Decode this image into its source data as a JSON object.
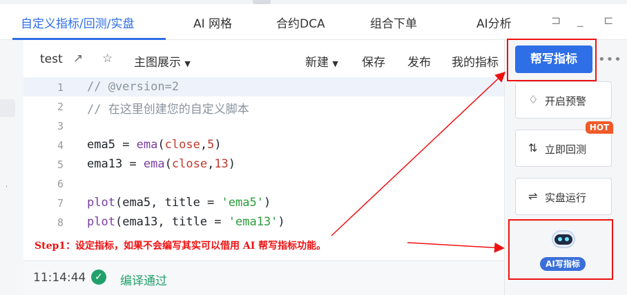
{
  "tabs": [
    {
      "label": "自定义指标/回测/实盘",
      "active": true
    },
    {
      "label": "AI 网格"
    },
    {
      "label": "合约DCA"
    },
    {
      "label": "组合下单"
    },
    {
      "label": "AI分析"
    }
  ],
  "window_controls": {
    "restore_glyph": "⊐",
    "minimize_glyph": "_",
    "maximize_glyph": "⊏"
  },
  "toolbar": {
    "script_name": "test",
    "chart_display": "主图展示",
    "new": "新建",
    "save": "保存",
    "publish": "发布",
    "my_indicators": "我的指标",
    "help_write": "帮写指标",
    "more": "•••"
  },
  "editor": {
    "lines": [
      {
        "no": "1",
        "comment": "// @version=2"
      },
      {
        "no": "2",
        "comment": "// 在这里创建您的自定义脚本"
      },
      {
        "no": "3"
      },
      {
        "no": "4",
        "var": "ema5",
        "op": " = ",
        "fn": "ema",
        "open": "(",
        "arg": "close",
        "sep": ",",
        "num": "5",
        "close": ")"
      },
      {
        "no": "5",
        "var": "ema13",
        "op": " = ",
        "fn": "ema",
        "open": "(",
        "arg": "close",
        "sep": ",",
        "num": "13",
        "close": ")"
      },
      {
        "no": "6"
      },
      {
        "no": "7",
        "fn": "plot",
        "open": "(",
        "var": "ema5",
        "mid": ", title = ",
        "str": "'ema5'",
        "close": ")"
      },
      {
        "no": "8",
        "fn": "plot",
        "open": "(",
        "var": "ema13",
        "mid": ", title = ",
        "str": "'ema13'",
        "close": ")"
      }
    ]
  },
  "status": {
    "time": "11:14:44",
    "message": "编译通过"
  },
  "right_panel": {
    "alert": "开启预警",
    "backtest": "立即回测",
    "hot_badge": "HOT",
    "live_run": "实盘运行",
    "ai_write": "AI写指标"
  },
  "annotation": {
    "text": "Step1：设定指标，如果不会编写其实可以借用 AI 帮写指标功能。"
  },
  "colors": {
    "accent": "#2e6ee6",
    "annotation_red": "#e11111",
    "success": "#22a06b",
    "hot": "#f05a28"
  }
}
